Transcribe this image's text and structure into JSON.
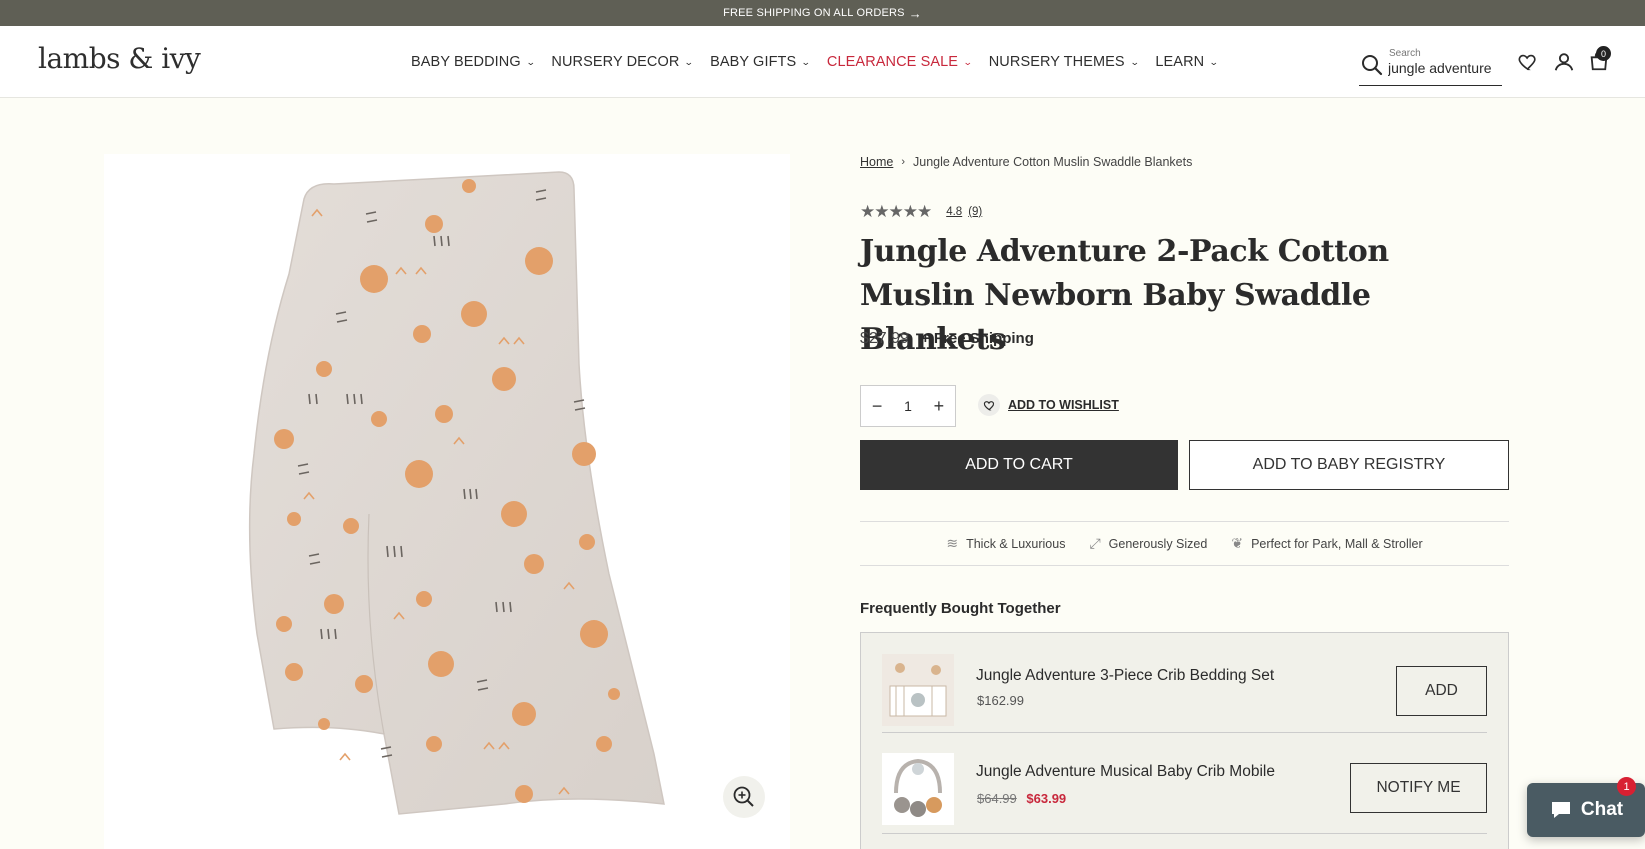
{
  "announcement": {
    "text": "FREE SHIPPING ON ALL ORDERS",
    "arrow_icon": "arrow-right-icon"
  },
  "header": {
    "logo": "lambs & ivy",
    "nav": [
      {
        "label": "BABY BEDDING"
      },
      {
        "label": "NURSERY DECOR"
      },
      {
        "label": "BABY GIFTS"
      },
      {
        "label": "CLEARANCE SALE",
        "highlight": true
      },
      {
        "label": "NURSERY THEMES"
      },
      {
        "label": "LEARN"
      }
    ],
    "search": {
      "label": "Search",
      "value": "jungle adventure"
    },
    "icons": [
      "search-icon",
      "heart-icon",
      "account-icon",
      "cart-icon"
    ],
    "cart_count": "0"
  },
  "breadcrumb": {
    "home": "Home",
    "current": "Jungle Adventure Cotton Muslin Swaddle Blankets"
  },
  "product": {
    "rating": "4.8",
    "review_count": "(9)",
    "title": "Jungle Adventure 2-Pack Cotton Muslin Newborn Baby Swaddle Blankets",
    "price": "$27.99",
    "shipping": "+ Free Shipping",
    "quantity": "1",
    "wishlist_label": "ADD TO WISHLIST",
    "add_to_cart": "ADD TO CART",
    "add_to_registry": "ADD TO BABY REGISTRY",
    "features": [
      {
        "label": "Thick & Luxurious",
        "icon": "fabric-icon"
      },
      {
        "label": "Generously Sized",
        "icon": "expand-icon"
      },
      {
        "label": "Perfect for Park, Mall & Stroller",
        "icon": "leaf-icon"
      }
    ]
  },
  "frequently_bought": {
    "title": "Frequently Bought Together",
    "items": [
      {
        "name": "Jungle Adventure 3-Piece Crib Bedding Set",
        "price": "$162.99",
        "button": "ADD"
      },
      {
        "name": "Jungle Adventure Musical Baby Crib Mobile",
        "old_price": "$64.99",
        "sale_price": "$63.99",
        "button": "NOTIFY ME"
      }
    ]
  },
  "chat": {
    "label": "Chat",
    "badge": "1"
  },
  "colors": {
    "accent_sale": "#c8283c",
    "button_dark": "#333333",
    "announcement_bg": "#5f5f55"
  }
}
